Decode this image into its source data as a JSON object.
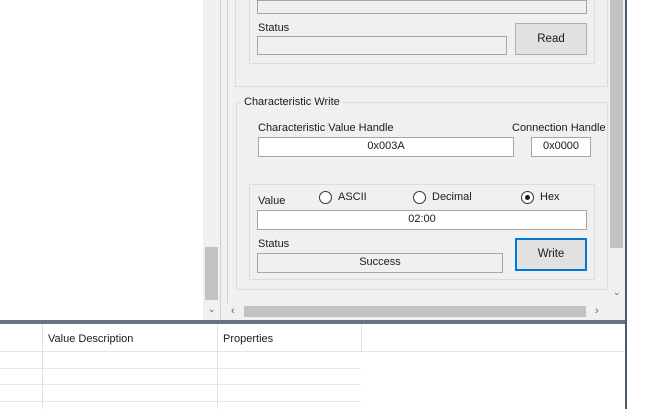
{
  "read_section": {
    "status_label": "Status",
    "status_value": "",
    "read_button": "Read"
  },
  "write_section": {
    "group_title": "Characteristic Write",
    "handle_label": "Characteristic Value Handle",
    "handle_value": "0x003A",
    "conn_label": "Connection Handle",
    "conn_value": "0x0000",
    "value_label": "Value",
    "radio_options": [
      {
        "label": "ASCII",
        "checked": false
      },
      {
        "label": "Decimal",
        "checked": false
      },
      {
        "label": "Hex",
        "checked": true
      }
    ],
    "value_input": "02:00",
    "status_label": "Status",
    "status_value": "Success",
    "write_button": "Write"
  },
  "table": {
    "columns": [
      "",
      "Value Description",
      "Properties",
      ""
    ]
  }
}
